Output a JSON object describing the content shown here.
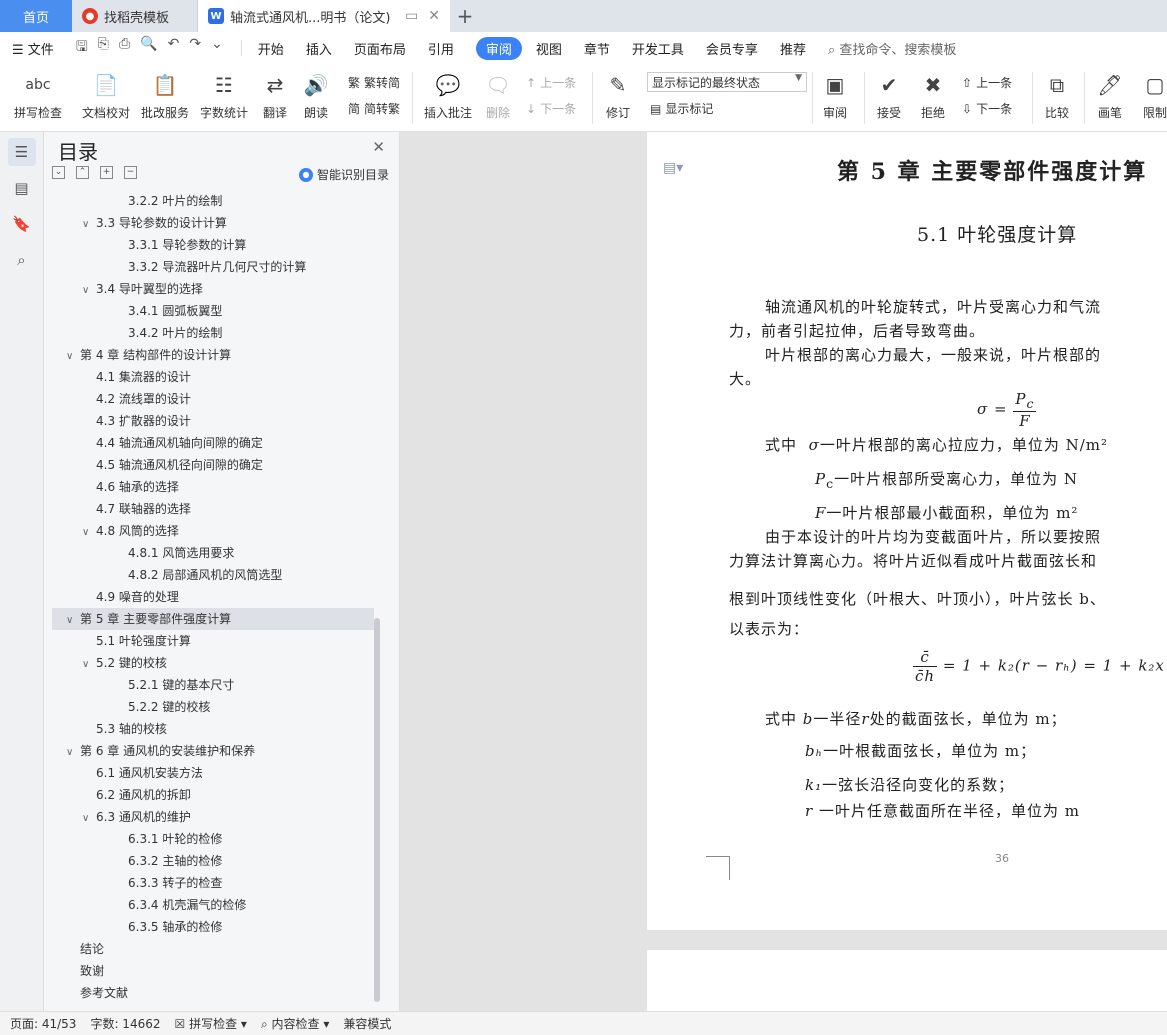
{
  "tabs": {
    "home": "首页",
    "template": "找稻壳模板",
    "doc": "轴流式通风机...明书（论文)",
    "new_tab": "+"
  },
  "menu": {
    "file": "文件",
    "items": [
      "开始",
      "插入",
      "页面布局",
      "引用",
      "审阅",
      "视图",
      "章节",
      "开发工具",
      "会员专享",
      "推荐"
    ],
    "active": "审阅",
    "search": "查找命令、搜索模板"
  },
  "ribbon": {
    "spell": "拼写检查",
    "spell_icon": "abc",
    "proof": "文档校对",
    "review_service": "批改服务",
    "word_count": "字数统计",
    "translate": "翻译",
    "read_aloud": "朗读",
    "trad": "繁转简",
    "simp": "简转繁",
    "insert_comment": "插入批注",
    "delete": "删除",
    "prev": "上一条",
    "next": "下一条",
    "track": "修订",
    "markup_state": "显示标记的最终状态",
    "show_markup": "显示标记",
    "review": "审阅",
    "accept": "接受",
    "reject": "拒绝",
    "prev2": "上一条",
    "next2": "下一条",
    "compare": "比较",
    "pen": "画笔",
    "restrict": "限制"
  },
  "toc": {
    "title": "目录",
    "smart": "智能识别目录",
    "items": [
      {
        "text": "3.2.2 叶片的绘制",
        "level": 3,
        "chev": false
      },
      {
        "text": "3.3 导轮参数的设计计算",
        "level": 2,
        "chev": true
      },
      {
        "text": "3.3.1 导轮参数的计算",
        "level": 3,
        "chev": false
      },
      {
        "text": "3.3.2 导流器叶片几何尺寸的计算",
        "level": 3,
        "chev": false
      },
      {
        "text": "3.4 导叶翼型的选择",
        "level": 2,
        "chev": true
      },
      {
        "text": "3.4.1  圆弧板翼型",
        "level": 3,
        "chev": false
      },
      {
        "text": "3.4.2 叶片的绘制",
        "level": 3,
        "chev": false
      },
      {
        "text": "第 4 章  结构部件的设计计算",
        "level": 1,
        "chev": true
      },
      {
        "text": "4.1 集流器的设计",
        "level": 2,
        "chev": false
      },
      {
        "text": "4.2 流线罩的设计",
        "level": 2,
        "chev": false
      },
      {
        "text": "4.3 扩散器的设计",
        "level": 2,
        "chev": false
      },
      {
        "text": "4.4 轴流通风机轴向间隙的确定",
        "level": 2,
        "chev": false
      },
      {
        "text": "4.5 轴流通风机径向间隙的确定",
        "level": 2,
        "chev": false
      },
      {
        "text": "4.6 轴承的选择",
        "level": 2,
        "chev": false
      },
      {
        "text": "4.7 联轴器的选择",
        "level": 2,
        "chev": false
      },
      {
        "text": "4.8 风筒的选择",
        "level": 2,
        "chev": true
      },
      {
        "text": "4.8.1 风筒选用要求",
        "level": 3,
        "chev": false
      },
      {
        "text": "4.8.2 局部通风机的风筒选型",
        "level": 3,
        "chev": false
      },
      {
        "text": "4.9 噪音的处理",
        "level": 2,
        "chev": false
      },
      {
        "text": "第 5 章  主要零部件强度计算",
        "level": 1,
        "chev": true,
        "selected": true
      },
      {
        "text": "5.1 叶轮强度计算",
        "level": 2,
        "chev": false
      },
      {
        "text": "5.2 键的校核",
        "level": 2,
        "chev": true
      },
      {
        "text": "5.2.1  键的基本尺寸",
        "level": 3,
        "chev": false
      },
      {
        "text": "5.2.2  键的校核",
        "level": 3,
        "chev": false
      },
      {
        "text": "5.3 轴的校核",
        "level": 2,
        "chev": false
      },
      {
        "text": "第 6 章  通风机的安装维护和保养",
        "level": 1,
        "chev": true
      },
      {
        "text": "6.1 通风机安装方法",
        "level": 2,
        "chev": false
      },
      {
        "text": "6.2 通风机的拆卸",
        "level": 2,
        "chev": false
      },
      {
        "text": "6.3 通风机的维护",
        "level": 2,
        "chev": true
      },
      {
        "text": "6.3.1 叶轮的检修",
        "level": 3,
        "chev": false
      },
      {
        "text": "6.3.2 主轴的检修",
        "level": 3,
        "chev": false
      },
      {
        "text": "6.3.3 转子的检查",
        "level": 3,
        "chev": false
      },
      {
        "text": "6.3.4 机壳漏气的检修",
        "level": 3,
        "chev": false
      },
      {
        "text": "6.3.5 轴承的检修",
        "level": 3,
        "chev": false
      },
      {
        "text": "结论",
        "level": 1,
        "chev": false
      },
      {
        "text": "致谢",
        "level": 1,
        "chev": false
      },
      {
        "text": "参考文献",
        "level": 1,
        "chev": false
      }
    ]
  },
  "doc": {
    "chapter": "第 5 章  主要零部件强度计算",
    "section": "5.1 叶轮强度计算",
    "p1a": "轴流通风机的叶轮旋转式，叶片受离心力和气流",
    "p1b": "力，前者引起拉伸，后者导致弯曲。",
    "p2a": "叶片根部的离心力最大，一般来说，叶片根部的",
    "p2b": "大。",
    "eq1_lhs": "σ =",
    "eq1_num": "P",
    "eq1_num_sub": "c",
    "eq1_den": "F",
    "where1": "式中",
    "where1_sym": "σ",
    "where1_text": "一叶片根部的离心拉应力，单位为 N/m²",
    "w2_sym": "P",
    "w2_sub": "c",
    "w2_text": "一叶片根部所受离心力，单位为 N",
    "w3_sym": "F",
    "w3_text": "一叶片根部最小截面积，单位为 m²",
    "p3a": "由于本设计的叶片均为变截面叶片，所以要按照",
    "p3b": "力算法计算离心力。将叶片近似看成叶片截面弦长和",
    "p4a": "根到叶顶线性变化（叶根大、叶顶小），叶片弦长 b、",
    "p4b": "以表示为：",
    "eq2_num": "c̄",
    "eq2_den": "c̄h",
    "eq2_rhs": "= 1 + k₂(r − rₕ) = 1 + k₂x",
    "w4_pre": "式中",
    "w4_sym": "b",
    "w4_text": "一半径",
    "w4_r": "r",
    "w4_text2": "处的截面弦长，单位为 m；",
    "w5_sym": "bₕ",
    "w5_text": "一叶根截面弦长，单位为 m；",
    "w6_sym": "k₁",
    "w6_text": "一弦长沿径向变化的系数；",
    "w7_sym": "r",
    "w7_text": "一叶片任意截面所在半径，单位为 m",
    "page_no": "36"
  },
  "status": {
    "page": "页面: 41/53",
    "words": "字数: 14662",
    "spell": "拼写检查",
    "content": "内容检查",
    "compat": "兼容模式"
  },
  "colors": {
    "accent": "#3b82f6",
    "tab_home": "#4a8ef0"
  }
}
